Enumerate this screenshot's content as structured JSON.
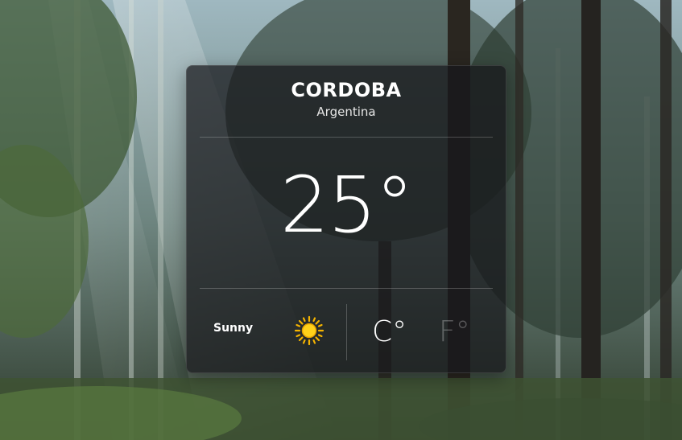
{
  "location": {
    "city": "CORDOBA",
    "country": "Argentina"
  },
  "current": {
    "temperature": "25°",
    "condition": "Sunny",
    "condition_icon": "sun-icon"
  },
  "units": {
    "celsius": "C°",
    "fahrenheit": "F°",
    "selected": "celsius"
  },
  "colors": {
    "card_background": "#16161a",
    "text": "#ffffff",
    "sun": "#f5b400"
  }
}
